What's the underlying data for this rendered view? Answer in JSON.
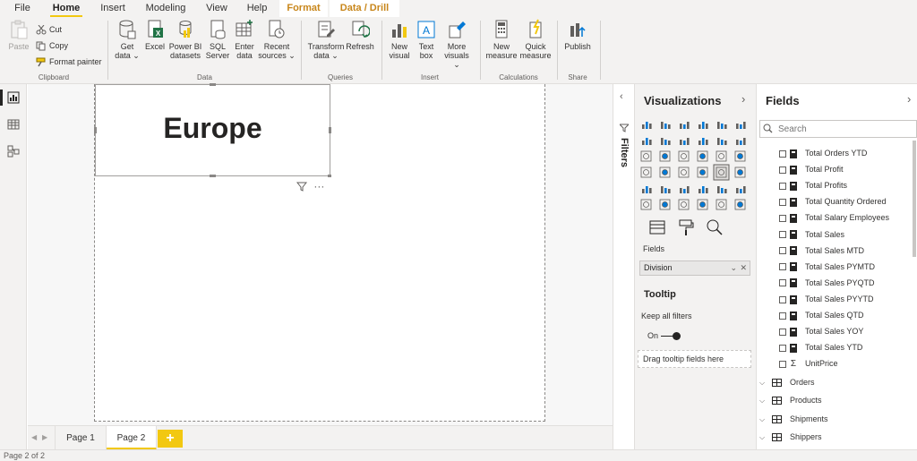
{
  "menu": {
    "tabs": [
      {
        "label": "File"
      },
      {
        "label": "Home"
      },
      {
        "label": "Insert"
      },
      {
        "label": "Modeling"
      },
      {
        "label": "View"
      },
      {
        "label": "Help"
      },
      {
        "label": "Format"
      },
      {
        "label": "Data / Drill"
      }
    ]
  },
  "ribbon": {
    "clipboard": {
      "paste": "Paste",
      "cut": "Cut",
      "copy": "Copy",
      "format_painter": "Format painter",
      "group": "Clipboard"
    },
    "data": {
      "get_data": [
        "Get",
        "data ⌄"
      ],
      "excel": "Excel",
      "powerbi": [
        "Power BI",
        "datasets"
      ],
      "sql": [
        "SQL",
        "Server"
      ],
      "enter": [
        "Enter",
        "data"
      ],
      "recent": [
        "Recent",
        "sources ⌄"
      ],
      "group": "Data"
    },
    "queries": {
      "transform": [
        "Transform",
        "data ⌄"
      ],
      "refresh": "Refresh",
      "group": "Queries"
    },
    "insert": {
      "new_visual": [
        "New",
        "visual"
      ],
      "text_box": [
        "Text",
        "box"
      ],
      "more": [
        "More",
        "visuals ⌄"
      ],
      "group": "Insert"
    },
    "calculations": {
      "new_measure": [
        "New",
        "measure"
      ],
      "quick_measure": [
        "Quick",
        "measure"
      ],
      "group": "Calculations"
    },
    "share": {
      "publish": "Publish",
      "group": "Share"
    }
  },
  "canvas": {
    "card_value": "Europe",
    "more_options": "···"
  },
  "pages": {
    "tabs": [
      {
        "label": "Page 1"
      },
      {
        "label": "Page 2"
      }
    ],
    "add": "+",
    "status": "Page 2 of 2"
  },
  "filters_pane": {
    "label": "Filters"
  },
  "visualizations": {
    "title": "Visualizations",
    "fields_label": "Fields",
    "field_well_value": "Division",
    "tooltip_title": "Tooltip",
    "keep_filters": "Keep all filters",
    "toggle_label": "On",
    "drop_hint": "Drag tooltip fields here"
  },
  "fields": {
    "title": "Fields",
    "search_placeholder": "Search",
    "measures": [
      {
        "name": "Total Orders YTD",
        "type": "calc"
      },
      {
        "name": "Total Profit",
        "type": "calc"
      },
      {
        "name": "Total Profits",
        "type": "calc"
      },
      {
        "name": "Total Quantity Ordered",
        "type": "calc"
      },
      {
        "name": "Total Salary Employees",
        "type": "calc"
      },
      {
        "name": "Total Sales",
        "type": "calc"
      },
      {
        "name": "Total Sales MTD",
        "type": "calc"
      },
      {
        "name": "Total Sales PYMTD",
        "type": "calc"
      },
      {
        "name": "Total Sales PYQTD",
        "type": "calc"
      },
      {
        "name": "Total Sales PYYTD",
        "type": "calc"
      },
      {
        "name": "Total Sales QTD",
        "type": "calc"
      },
      {
        "name": "Total Sales YOY",
        "type": "calc"
      },
      {
        "name": "Total Sales YTD",
        "type": "calc"
      },
      {
        "name": "UnitPrice",
        "type": "sum"
      }
    ],
    "tables": [
      {
        "name": "Orders"
      },
      {
        "name": "Products"
      },
      {
        "name": "Shipments"
      },
      {
        "name": "Shippers"
      }
    ]
  },
  "colors": {
    "accent": "#f2c811",
    "format_tab": "#c8861a"
  }
}
